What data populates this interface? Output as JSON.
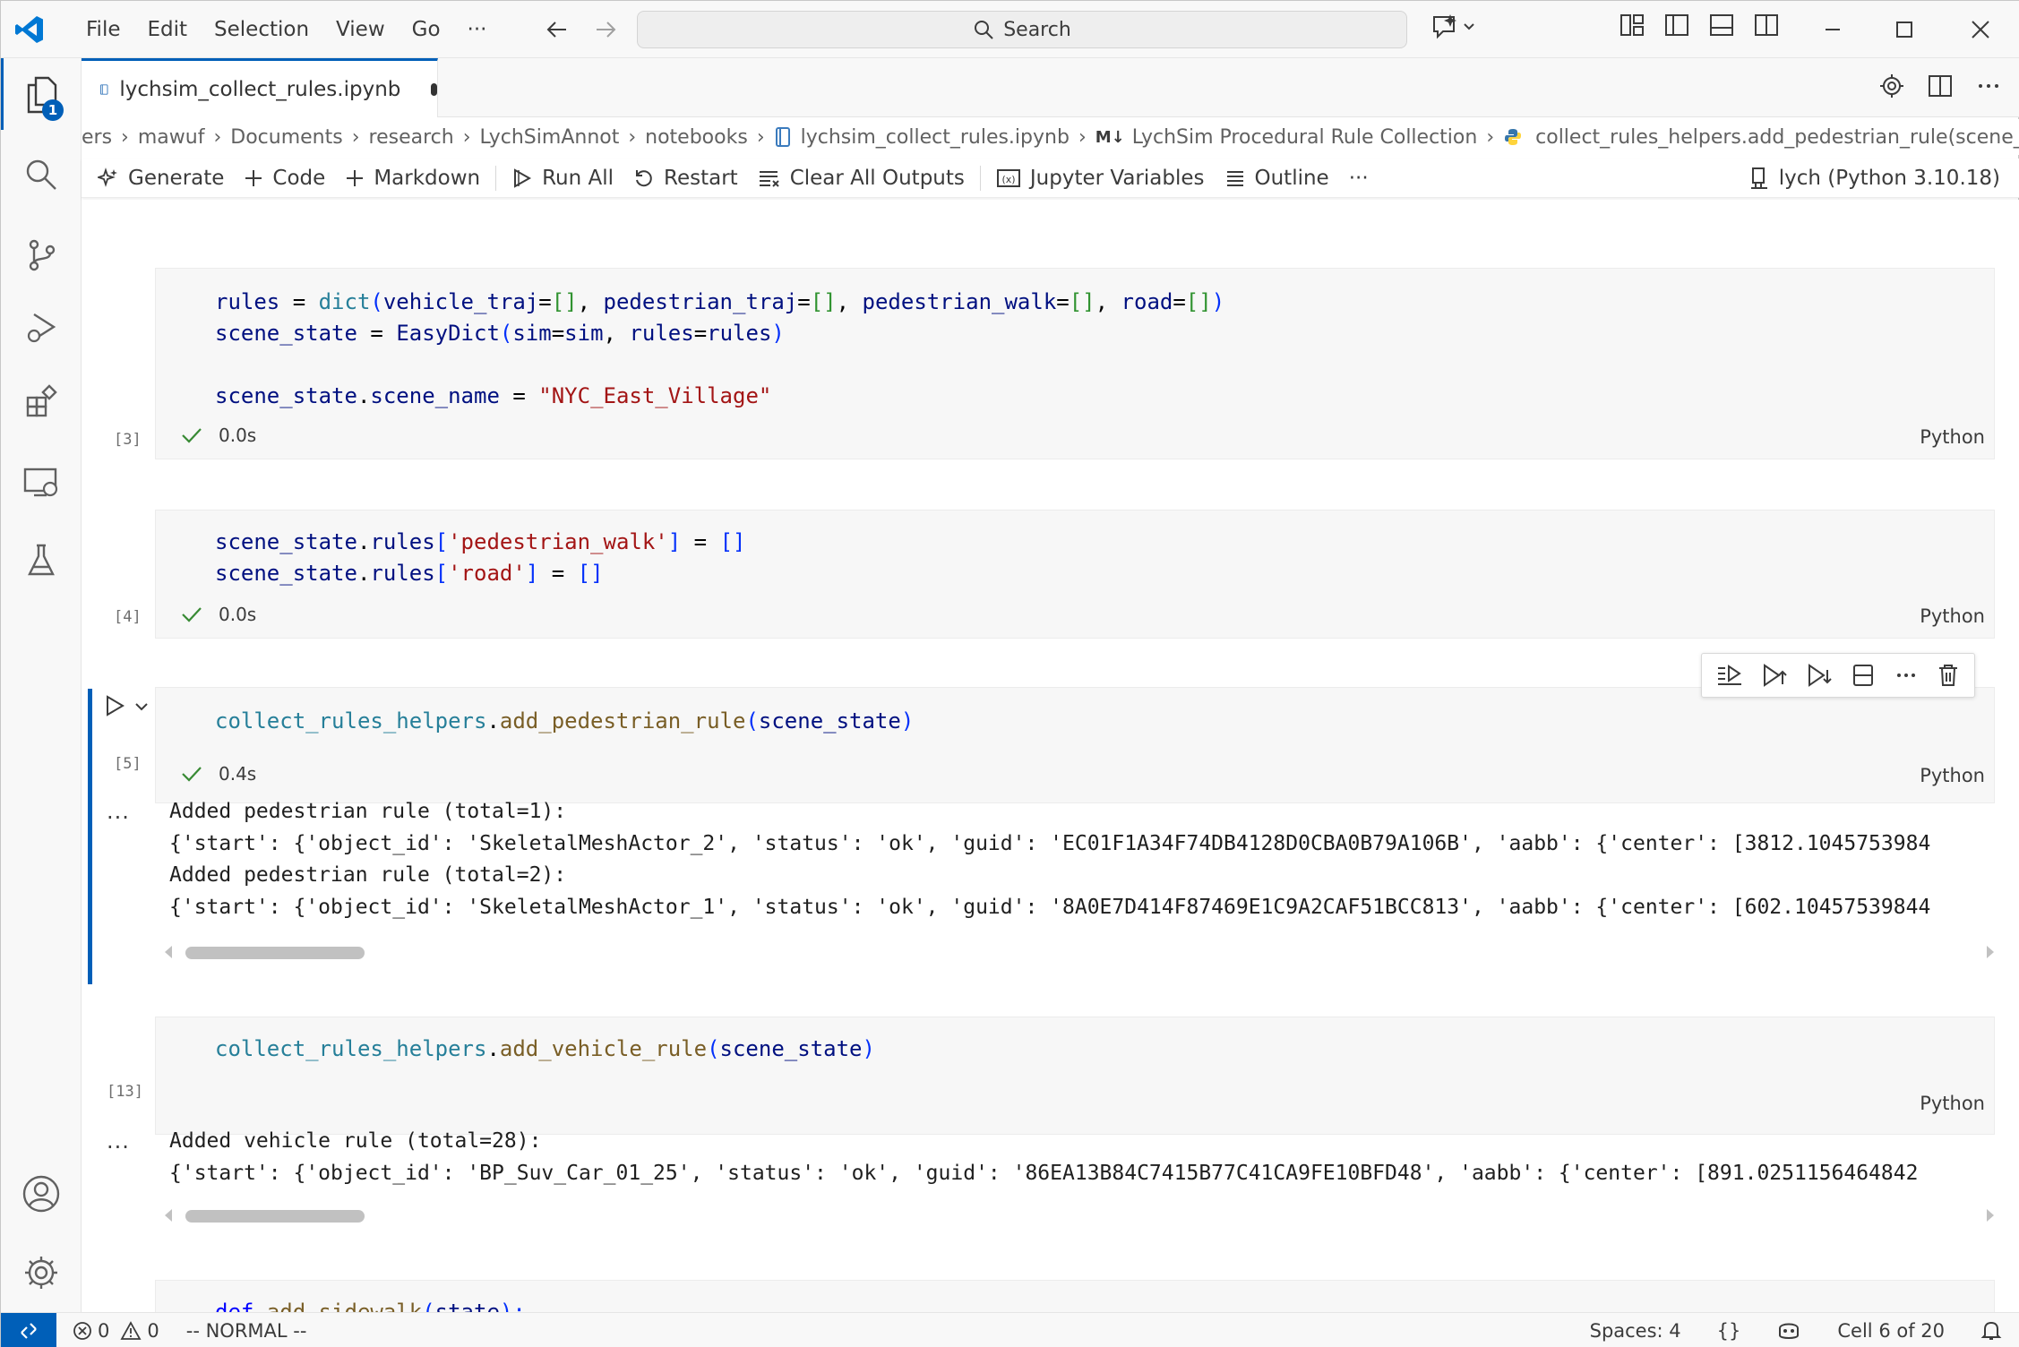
{
  "menu": [
    "File",
    "Edit",
    "Selection",
    "View",
    "Go",
    "···"
  ],
  "search": {
    "label": "Search"
  },
  "activity_badge": "1",
  "tab": {
    "title": "lychsim_collect_rules.ipynb"
  },
  "breadcrumb": {
    "items": [
      "ers",
      "mawuf",
      "Documents",
      "research",
      "LychSimAnnot",
      "notebooks"
    ],
    "file": "lychsim_collect_rules.ipynb",
    "md_prefix": "M↓",
    "section": "LychSim Procedural Rule Collection",
    "symbol": "collect_rules_helpers.add_pedestrian_rule(scene_sta"
  },
  "toolbar": {
    "generate": "Generate",
    "code": "Code",
    "markdown": "Markdown",
    "run_all": "Run All",
    "restart": "Restart",
    "clear_outputs": "Clear All Outputs",
    "variables": "Jupyter Variables",
    "outline": "Outline",
    "more": "···",
    "kernel": "lych (Python 3.10.18)"
  },
  "cells": {
    "c3": {
      "exec": "[3]",
      "time": "0.0s",
      "lang": "Python"
    },
    "c4": {
      "exec": "[4]",
      "time": "0.0s",
      "lang": "Python"
    },
    "c5": {
      "exec": "[5]",
      "time": "0.4s",
      "lang": "Python",
      "output": [
        "Added pedestrian rule (total=1):",
        "{'start': {'object_id': 'SkeletalMeshActor_2', 'status': 'ok', 'guid': 'EC01F1A34F74DB4128D0CBA0B79A106B', 'aabb': {'center': [3812.1045753984",
        "Added pedestrian rule (total=2):",
        "{'start': {'object_id': 'SkeletalMeshActor_1', 'status': 'ok', 'guid': '8A0E7D414F87469E1C9A2CAF51BCC813', 'aabb': {'center': [602.10457539844"
      ]
    },
    "c13": {
      "exec": "[13]",
      "lang": "Python",
      "output": [
        "Added vehicle rule (total=28):",
        "{'start': {'object_id': 'BP_Suv_Car_01_25', 'status': 'ok', 'guid': '86EA13B84C7415B77C41CA9FE10BFD48', 'aabb': {'center': [891.0251156464842"
      ]
    }
  },
  "code": {
    "c3": {
      "l1": [
        "rules",
        " = ",
        "dict",
        "(",
        "vehicle_traj",
        "=",
        "[]",
        ", ",
        "pedestrian_traj",
        "=",
        "[]",
        ", ",
        "pedestrian_walk",
        "=",
        "[]",
        ", ",
        "road",
        "=",
        "[]",
        ")"
      ],
      "l2": [
        "scene_state",
        " = ",
        "EasyDict",
        "(",
        "sim",
        "=",
        "sim",
        ", ",
        "rules",
        "=",
        "rules",
        ")"
      ],
      "l4": [
        "scene_state",
        ".",
        "scene_name",
        " = ",
        "\"NYC_East_Village\""
      ]
    },
    "c4": {
      "l1": [
        "scene_state",
        ".",
        "rules",
        "[",
        "'pedestrian_walk'",
        "]",
        " = ",
        "[]"
      ],
      "l2": [
        "scene_state",
        ".",
        "rules",
        "[",
        "'road'",
        "]",
        " = ",
        "[]"
      ]
    },
    "c5": {
      "l1": [
        "collect_rules_helpers",
        ".",
        "add_pedestrian_rule",
        "(",
        "scene_state",
        ")"
      ]
    },
    "c13": {
      "l1": [
        "collect_rules_helpers",
        ".",
        "add_vehicle_rule",
        "(",
        "scene_state",
        ")"
      ]
    },
    "c_next": {
      "l1": [
        "def",
        " ",
        "add_sidewalk",
        "(",
        "state",
        "):"
      ]
    }
  },
  "output_more": "···",
  "statusbar": {
    "errors": "0",
    "warnings": "0",
    "mode": "-- NORMAL --",
    "spaces": "Spaces: 4",
    "braces": "{}",
    "cell_pos": "Cell 6 of 20"
  },
  "colors": {
    "accent": "#005fb8",
    "string": "#a31515",
    "function": "#795e26",
    "class": "#267f99",
    "variable": "#001080"
  }
}
